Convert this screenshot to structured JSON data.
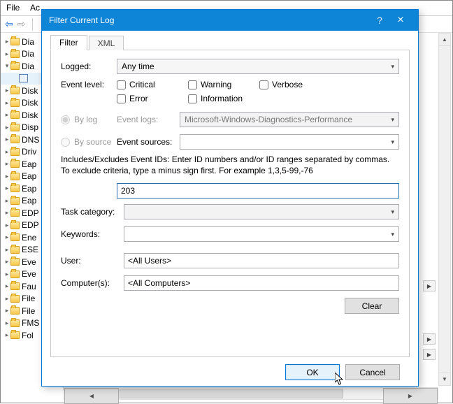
{
  "menu": {
    "file": "File",
    "action": "Ac"
  },
  "tree": {
    "items": [
      {
        "label": "Dia",
        "lvl": 1,
        "caret": ">"
      },
      {
        "label": "Dia",
        "lvl": 1,
        "caret": ">"
      },
      {
        "label": "Dia",
        "lvl": 1,
        "caret": "v",
        "sel": false
      },
      {
        "label": "",
        "lvl": 2,
        "caret": "",
        "sel": true,
        "file": true
      },
      {
        "label": "Disk",
        "lvl": 1,
        "caret": ">"
      },
      {
        "label": "Disk",
        "lvl": 1,
        "caret": ">"
      },
      {
        "label": "Disk",
        "lvl": 1,
        "caret": ">"
      },
      {
        "label": "Disp",
        "lvl": 1,
        "caret": ">"
      },
      {
        "label": "DNS",
        "lvl": 1,
        "caret": ">"
      },
      {
        "label": "Driv",
        "lvl": 1,
        "caret": ">"
      },
      {
        "label": "Eap",
        "lvl": 1,
        "caret": ">"
      },
      {
        "label": "Eap",
        "lvl": 1,
        "caret": ">"
      },
      {
        "label": "Eap",
        "lvl": 1,
        "caret": ">"
      },
      {
        "label": "Eap",
        "lvl": 1,
        "caret": ">"
      },
      {
        "label": "EDP",
        "lvl": 1,
        "caret": ">"
      },
      {
        "label": "EDP",
        "lvl": 1,
        "caret": ">"
      },
      {
        "label": "Ene",
        "lvl": 1,
        "caret": ">"
      },
      {
        "label": "ESE",
        "lvl": 1,
        "caret": ">"
      },
      {
        "label": "Eve",
        "lvl": 1,
        "caret": ">"
      },
      {
        "label": "Eve",
        "lvl": 1,
        "caret": ">"
      },
      {
        "label": "Fau",
        "lvl": 1,
        "caret": ">"
      },
      {
        "label": "File",
        "lvl": 1,
        "caret": ">"
      },
      {
        "label": "File",
        "lvl": 1,
        "caret": ">"
      },
      {
        "label": "FMS",
        "lvl": 1,
        "caret": ">"
      },
      {
        "label": "Fol",
        "lvl": 1,
        "caret": ">"
      }
    ]
  },
  "dialog": {
    "title": "Filter Current Log",
    "tabs": {
      "filter": "Filter",
      "xml": "XML"
    },
    "logged_label": "Logged:",
    "logged_value": "Any time",
    "event_level_label": "Event level:",
    "levels": {
      "critical": "Critical",
      "warning": "Warning",
      "verbose": "Verbose",
      "error": "Error",
      "information": "Information"
    },
    "by_log": "By log",
    "by_source": "By source",
    "event_logs_label": "Event logs:",
    "event_logs_value": "Microsoft-Windows-Diagnostics-Performance",
    "event_sources_label": "Event sources:",
    "event_sources_value": "",
    "help_text": "Includes/Excludes Event IDs: Enter ID numbers and/or ID ranges separated by commas. To exclude criteria, type a minus sign first. For example 1,3,5-99,-76",
    "event_id_value": "203",
    "task_category_label": "Task category:",
    "task_category_value": "",
    "keywords_label": "Keywords:",
    "keywords_value": "",
    "user_label": "User:",
    "user_value": "<All Users>",
    "computers_label": "Computer(s):",
    "computers_value": "<All Computers>",
    "clear": "Clear",
    "ok": "OK",
    "cancel": "Cancel"
  }
}
